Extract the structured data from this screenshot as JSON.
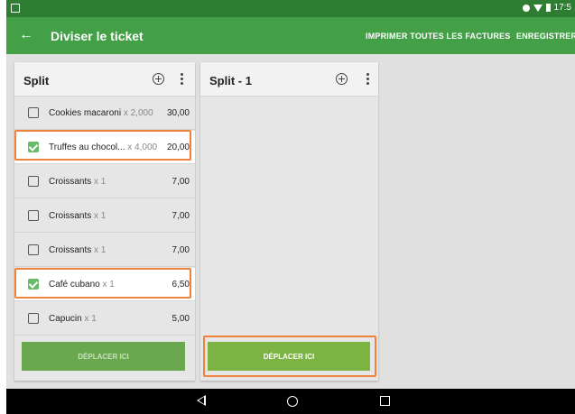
{
  "status_bar": {
    "time": "17:5"
  },
  "app_bar": {
    "back_label": "←",
    "title": "Diviser le ticket",
    "actions": [
      "IMPRIMER TOUTES LES FACTURES",
      "ENREGISTRER"
    ]
  },
  "left_panel": {
    "title": "Split",
    "items": [
      {
        "name": "Cookies macaroni",
        "qty": "x 2,000",
        "price": "30,00",
        "checked": false
      },
      {
        "name": "Truffes au chocol...",
        "qty": "x 4,000",
        "price": "20,00",
        "checked": true
      },
      {
        "name": "Croissants",
        "qty": "x 1",
        "price": "7,00",
        "checked": false
      },
      {
        "name": "Croissants",
        "qty": "x 1",
        "price": "7,00",
        "checked": false
      },
      {
        "name": "Croissants",
        "qty": "x 1",
        "price": "7,00",
        "checked": false
      },
      {
        "name": "Café cubano",
        "qty": "x 1",
        "price": "6,50",
        "checked": true
      },
      {
        "name": "Capucin",
        "qty": "x 1",
        "price": "5,00",
        "checked": false
      }
    ],
    "move_button": "DÉPLACER ICI",
    "move_button_color": "#6aa84f"
  },
  "right_panel": {
    "title": "Split - 1",
    "move_button": "DÉPLACER ICI",
    "move_button_color": "#7cb342"
  },
  "colors": {
    "status_bar": "#2e7d32",
    "app_bar": "#43a047",
    "highlight": "#f0833a",
    "checkbox_checked": "#66bb6a"
  }
}
